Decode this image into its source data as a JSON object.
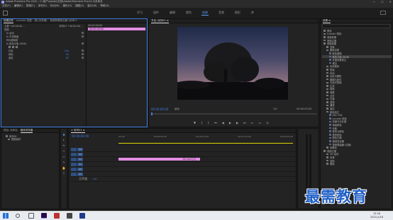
{
  "app": {
    "title": "Adobe Premiere Pro 2020 - C:\\用户\\Adobe\\文档\\Adobe\\Premiere Pro\\14.0\\未命名",
    "window_buttons": [
      "—",
      "☐",
      "✕"
    ]
  },
  "menu": [
    "文件(F)",
    "编辑(E)",
    "剪辑(C)",
    "序列(S)",
    "标记(M)",
    "图形(G)",
    "视图(V)",
    "窗口(W)",
    "帮助(H)"
  ],
  "workspaces": {
    "tabs": [
      "学习",
      "组件",
      "编辑",
      "颜色",
      "效果",
      "音频",
      "图形",
      "库"
    ],
    "active": "效果"
  },
  "effect_controls": {
    "tabs": [
      "效果控件",
      "Lumetri 范围",
      "源:(无剪辑)",
      "音频剪辑混合器: 序列01"
    ],
    "master": "主要 * 00:00:00 ...",
    "seq": "序列01 * 00:00:00 ...",
    "sections": [
      {
        "label": "视频",
        "indent": 0
      },
      {
        "label": "fx 运动",
        "indent": 1
      },
      {
        "label": "fx 不透明度",
        "indent": 1
      },
      {
        "label": "时间重映射",
        "indent": 1
      },
      {
        "label": "fx 颜色平衡 (RGB)",
        "indent": 1
      }
    ],
    "params": [
      {
        "label": "红色",
        "value": "100"
      },
      {
        "label": "绿色",
        "value": "90"
      },
      {
        "label": "蓝色",
        "value": "80"
      }
    ],
    "clip_label": "00:00:00:00",
    "clip_name": "00:00:00:00"
  },
  "program_monitor": {
    "title": "节目: 序列01 ≡",
    "timecode": "00:00:00:00",
    "fit": "适合",
    "fraction": "1/2",
    "duration": "00:00:05:00"
  },
  "project": {
    "tabs": [
      "项目: 未命名",
      "媒体浏览器"
    ],
    "items": [
      "序列01",
      "视频素材"
    ]
  },
  "timeline": {
    "title": "× 序列01 ≡",
    "timecode": "00:00:00:00",
    "ruler": [
      "00:00",
      "00:00:05:00",
      "00:00:10:00",
      "00:00:15:00",
      "00:00:20:00"
    ],
    "tracks": [
      "V3",
      "V2",
      "V1",
      "A1",
      "A2",
      "A3"
    ],
    "master": "主声道",
    "master_val": "0.0",
    "clip": "00.mp4 [V]"
  },
  "effects_panel": {
    "title": "效果 ≡",
    "items": [
      {
        "label": "预设",
        "depth": 0
      },
      {
        "label": "Lumetri 预设",
        "depth": 0
      },
      {
        "label": "音频效果",
        "depth": 0
      },
      {
        "label": "音频过渡",
        "depth": 0
      },
      {
        "label": "视频效果",
        "depth": 0
      },
      {
        "label": "变换",
        "depth": 1
      },
      {
        "label": "图像控制",
        "depth": 1
      },
      {
        "label": "颜色替换",
        "depth": 2
      },
      {
        "label": "颜色平衡 (RGB)",
        "depth": 2
      },
      {
        "label": "灰度系数校正",
        "depth": 2
      },
      {
        "label": "黑白",
        "depth": 2
      },
      {
        "label": "实用程序",
        "depth": 1
      },
      {
        "label": "扭曲",
        "depth": 1
      },
      {
        "label": "时间",
        "depth": 1
      },
      {
        "label": "杂色与颗粒",
        "depth": 1
      },
      {
        "label": "模糊与锐化",
        "depth": 1
      },
      {
        "label": "沉浸式视频",
        "depth": 1
      },
      {
        "label": "生成",
        "depth": 1
      },
      {
        "label": "视频",
        "depth": 1
      },
      {
        "label": "调整",
        "depth": 1
      },
      {
        "label": "过时",
        "depth": 1
      },
      {
        "label": "过渡",
        "depth": 1
      },
      {
        "label": "透视",
        "depth": 1
      },
      {
        "label": "通道",
        "depth": 1
      },
      {
        "label": "键控",
        "depth": 1
      },
      {
        "label": "颜色校正",
        "depth": 1
      },
      {
        "label": "ASC CDL",
        "depth": 2
      },
      {
        "label": "Lumetri 颜色",
        "depth": 2
      },
      {
        "label": "亮度与对比度",
        "depth": 2
      },
      {
        "label": "保留颜色",
        "depth": 2
      },
      {
        "label": "均衡",
        "depth": 2
      },
      {
        "label": "更改为颜色",
        "depth": 2
      },
      {
        "label": "更改颜色",
        "depth": 2
      },
      {
        "label": "颜色平衡",
        "depth": 2
      },
      {
        "label": "通道混合器",
        "depth": 2
      },
      {
        "label": "视频限幅器 (旧版)",
        "depth": 2
      },
      {
        "label": "风格化",
        "depth": 1
      },
      {
        "label": "视频过渡",
        "depth": 0
      },
      {
        "label": "3D 运动",
        "depth": 1
      },
      {
        "label": "内滑",
        "depth": 1
      },
      {
        "label": "划像",
        "depth": 1
      },
      {
        "label": "擦除",
        "depth": 1
      }
    ],
    "highlight_index": 8
  },
  "taskbar": {
    "time": "15:26",
    "date": "2021/1/16"
  },
  "watermark": "最需教育",
  "colors": {
    "accent": "#3e7de6",
    "clip": "#e38de3"
  }
}
